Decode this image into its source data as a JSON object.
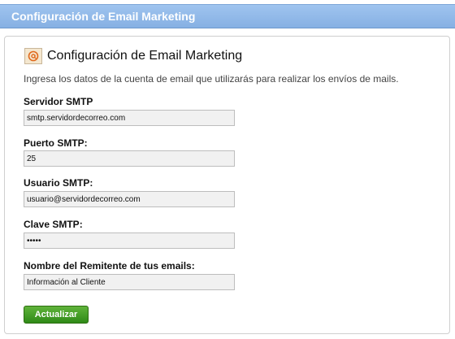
{
  "header": {
    "title": "Configuración de Email Marketing"
  },
  "section": {
    "title": "Configuración de Email Marketing",
    "icon": "email-icon",
    "intro": "Ingresa los datos de la cuenta de email que utilizarás para realizar los envíos de mails."
  },
  "form": {
    "smtp_server": {
      "label": "Servidor SMTP",
      "value": "smtp.servidordecorreo.com"
    },
    "smtp_port": {
      "label": "Puerto SMTP:",
      "value": "25"
    },
    "smtp_user": {
      "label": "Usuario SMTP:",
      "value": "usuario@servidordecorreo.com"
    },
    "smtp_password": {
      "label": "Clave SMTP:",
      "value": "•••••"
    },
    "sender_name": {
      "label": "Nombre del Remitente de tus emails:",
      "value": "Información al Cliente"
    },
    "submit_label": "Actualizar"
  },
  "colors": {
    "header_bar": "#8fb8e8",
    "button_green": "#3f9a22"
  }
}
